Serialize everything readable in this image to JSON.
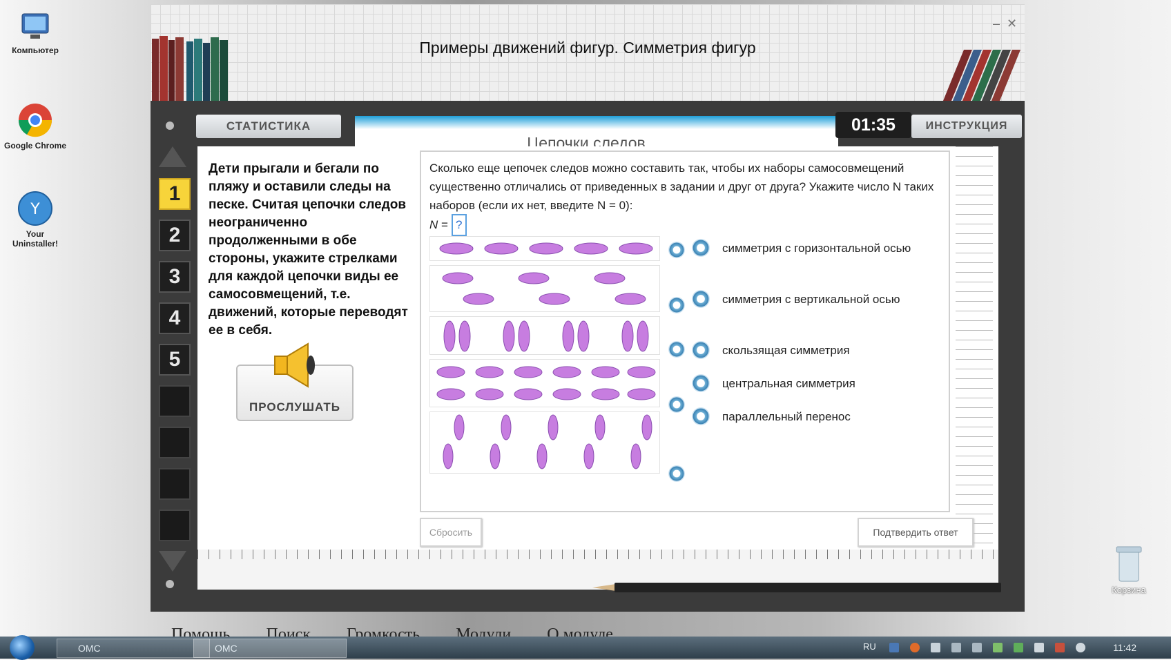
{
  "desktop": {
    "icons": [
      {
        "label": "Компьютер",
        "icon": "computer-icon"
      },
      {
        "label": "Google Chrome",
        "icon": "chrome-icon"
      },
      {
        "label": "Your Uninstaller!",
        "icon": "uninstaller-icon"
      }
    ],
    "recycle_bin": "Корзина"
  },
  "window": {
    "title": "Примеры движений фигур. Симметрия фигур",
    "minimize": "–",
    "close": "✕"
  },
  "header": {
    "stats_tab": "СТАТИСТИКА",
    "section_title": "Цепочки следов",
    "timer": "01:35",
    "instructions": "ИНСТРУКЦИЯ"
  },
  "nav": {
    "questions": [
      "1",
      "2",
      "3",
      "4",
      "5"
    ],
    "active": "1"
  },
  "task": {
    "text": "Дети прыгали и бегали по пляжу и оставили следы на песке. Считая цепочки следов неограниченно продолженными в обе стороны, укажите стрелками для каждой цепочки виды ее самосовмещений, т.е. движений, которые переводят ее в себя.",
    "listen_label": "ПРОСЛУШАТЬ"
  },
  "question": {
    "text": "Сколько еще цепочек следов можно составить так, чтобы их наборы самосовмещений существенно отличались от приведенных в задании и друг от друга? Укажите число N таких наборов (если их нет, введите N = 0):",
    "n_label": "N",
    "n_eq": "=",
    "n_value": "?",
    "options": [
      "симметрия с горизонтальной осью",
      "симметрия с вертикальной осью",
      "скользящая симметрия",
      "центральная симметрия",
      "параллельный перенос"
    ]
  },
  "buttons": {
    "reset": "Сбросить",
    "confirm": "Подтвердить ответ"
  },
  "menu": [
    "Помощь",
    "Поиск",
    "Громкость",
    "Модули",
    "О модуле"
  ],
  "taskbar": {
    "items": [
      "ОМС",
      "ОМС"
    ],
    "lang": "RU",
    "clock": "11:42"
  },
  "colors": {
    "accent_blue": "#1f9fd9",
    "active_number": "#f7d43a",
    "footprint": "#c77de0"
  }
}
